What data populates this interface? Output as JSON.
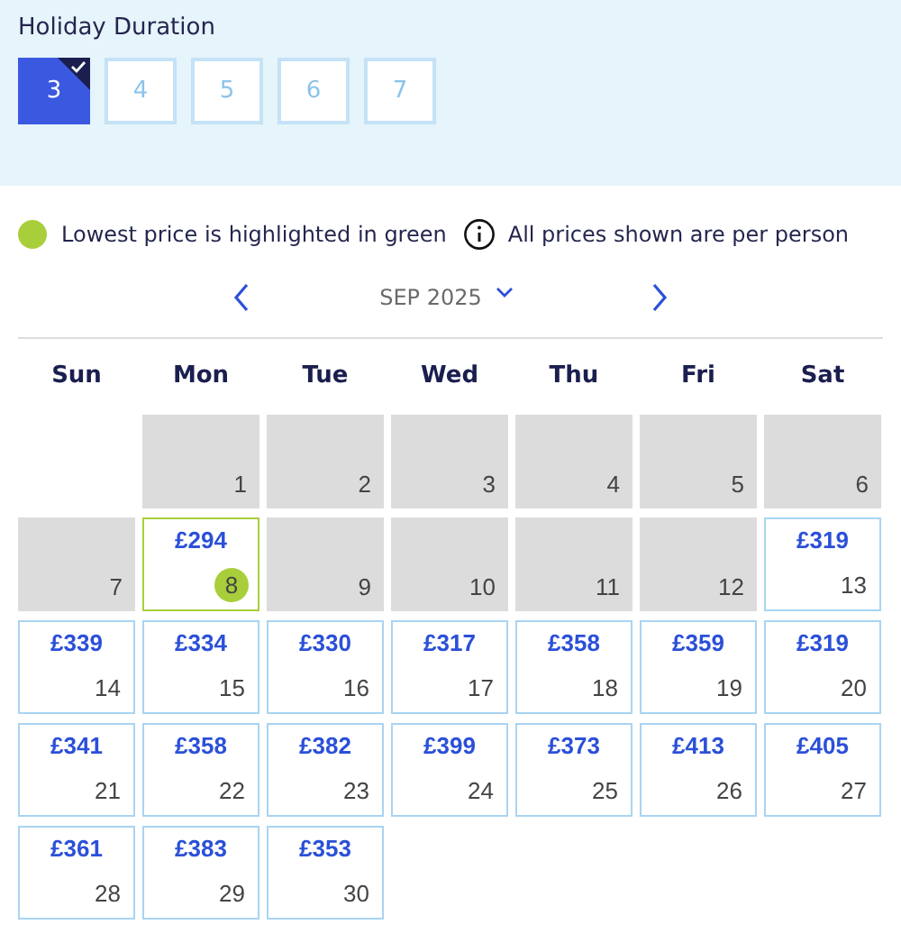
{
  "duration": {
    "title": "Holiday Duration",
    "options": [
      {
        "label": "3",
        "selected": true
      },
      {
        "label": "4",
        "selected": false
      },
      {
        "label": "5",
        "selected": false
      },
      {
        "label": "6",
        "selected": false
      },
      {
        "label": "7",
        "selected": false
      }
    ]
  },
  "legend": {
    "lowest": "Lowest price is highlighted in green",
    "info": "All prices shown are per person"
  },
  "calendar": {
    "month": "SEP 2025",
    "weekdays": [
      "Sun",
      "Mon",
      "Tue",
      "Wed",
      "Thu",
      "Fri",
      "Sat"
    ],
    "weeks": [
      [
        {
          "kind": "blank"
        },
        {
          "kind": "unavailable",
          "day": "1"
        },
        {
          "kind": "unavailable",
          "day": "2"
        },
        {
          "kind": "unavailable",
          "day": "3"
        },
        {
          "kind": "unavailable",
          "day": "4"
        },
        {
          "kind": "unavailable",
          "day": "5"
        },
        {
          "kind": "unavailable",
          "day": "6"
        }
      ],
      [
        {
          "kind": "unavailable",
          "day": "7"
        },
        {
          "kind": "priced",
          "day": "8",
          "price": "£294",
          "lowest": true
        },
        {
          "kind": "unavailable",
          "day": "9"
        },
        {
          "kind": "unavailable",
          "day": "10"
        },
        {
          "kind": "unavailable",
          "day": "11"
        },
        {
          "kind": "unavailable",
          "day": "12"
        },
        {
          "kind": "priced",
          "day": "13",
          "price": "£319",
          "lowest": false
        }
      ],
      [
        {
          "kind": "priced",
          "day": "14",
          "price": "£339",
          "lowest": false
        },
        {
          "kind": "priced",
          "day": "15",
          "price": "£334",
          "lowest": false
        },
        {
          "kind": "priced",
          "day": "16",
          "price": "£330",
          "lowest": false
        },
        {
          "kind": "priced",
          "day": "17",
          "price": "£317",
          "lowest": false
        },
        {
          "kind": "priced",
          "day": "18",
          "price": "£358",
          "lowest": false
        },
        {
          "kind": "priced",
          "day": "19",
          "price": "£359",
          "lowest": false
        },
        {
          "kind": "priced",
          "day": "20",
          "price": "£319",
          "lowest": false
        }
      ],
      [
        {
          "kind": "priced",
          "day": "21",
          "price": "£341",
          "lowest": false
        },
        {
          "kind": "priced",
          "day": "22",
          "price": "£358",
          "lowest": false
        },
        {
          "kind": "priced",
          "day": "23",
          "price": "£382",
          "lowest": false
        },
        {
          "kind": "priced",
          "day": "24",
          "price": "£399",
          "lowest": false
        },
        {
          "kind": "priced",
          "day": "25",
          "price": "£373",
          "lowest": false
        },
        {
          "kind": "priced",
          "day": "26",
          "price": "£413",
          "lowest": false
        },
        {
          "kind": "priced",
          "day": "27",
          "price": "£405",
          "lowest": false
        }
      ],
      [
        {
          "kind": "priced",
          "day": "28",
          "price": "£361",
          "lowest": false
        },
        {
          "kind": "priced",
          "day": "29",
          "price": "£383",
          "lowest": false
        },
        {
          "kind": "priced",
          "day": "30",
          "price": "£353",
          "lowest": false
        }
      ]
    ]
  }
}
